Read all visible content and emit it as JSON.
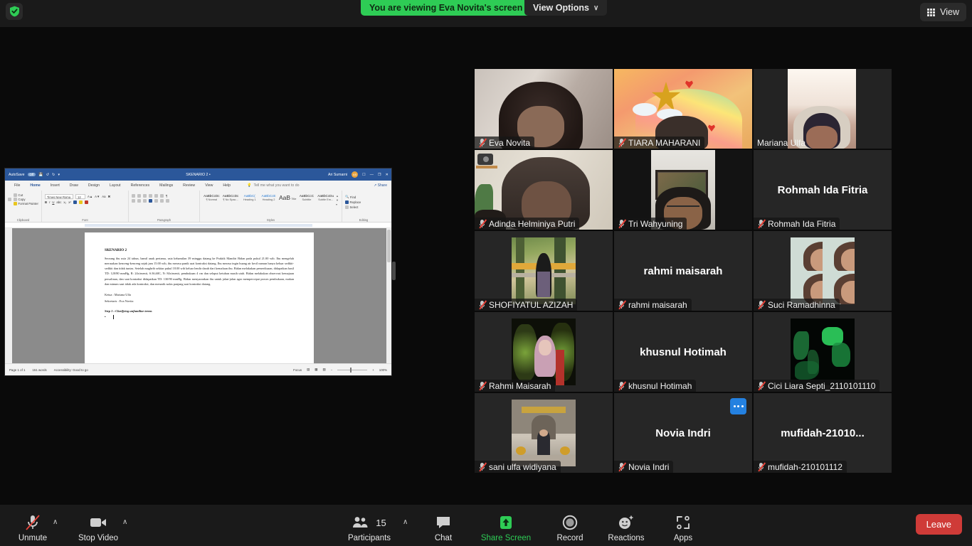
{
  "top_bar": {
    "shield_icon": "shield-check-icon",
    "viewing_banner": "You are viewing Eva Novita's screen",
    "view_options_label": "View Options",
    "view_options_chevron": "∨",
    "view_button_label": "View",
    "view_button_icon": "grid-icon"
  },
  "shared_screen": {
    "app": "Microsoft Word",
    "titlebar": {
      "autosave_label": "AutoSave",
      "autosave_state": "Off",
      "save_icon": "save-icon",
      "undo_icon": "undo-icon",
      "redo_icon": "redo-icon",
      "customize_icon": "customize-icon",
      "doc_title": "SKENARIO 2 •",
      "user_name": "Ari Sumarni",
      "user_initials": "AS",
      "ribbon_display_icon": "ribbon-display-icon",
      "minimize_icon": "—",
      "restore_icon": "❐",
      "close_icon": "✕"
    },
    "tabs": [
      "File",
      "Home",
      "Insert",
      "Draw",
      "Design",
      "Layout",
      "References",
      "Mailings",
      "Review",
      "View",
      "Help"
    ],
    "active_tab": "Home",
    "tell_me": "Tell me what you want to do",
    "share_label": "Share",
    "ribbon_groups": [
      "Clipboard",
      "Font",
      "Paragraph",
      "Styles",
      "Editing"
    ],
    "clipboard": {
      "paste_label": "Paste",
      "cut_label": "Cut",
      "copy_label": "Copy",
      "format_painter_label": "Format Painter"
    },
    "font": {
      "font_name": "Times New Roma",
      "font_size": "12",
      "bold": "B",
      "italic": "I",
      "underline": "U"
    },
    "styles": [
      {
        "preview": "AaBbCcDc",
        "name": "¶ Normal",
        "kind": "normal"
      },
      {
        "preview": "AaBbCcDc",
        "name": "¶ No Spac...",
        "kind": "normal"
      },
      {
        "preview": "AaBbC(",
        "name": "Heading 1",
        "kind": "heading"
      },
      {
        "preview": "AaBbCcE",
        "name": "Heading 2",
        "kind": "heading"
      },
      {
        "preview": "AaB",
        "name": "Title",
        "kind": "title"
      },
      {
        "preview": "AaBbCcC",
        "name": "Subtitle",
        "kind": "normal"
      },
      {
        "preview": "AaBbCcDu",
        "name": "Subtle Em...",
        "kind": "normal"
      }
    ],
    "editing": {
      "find_label": "Find",
      "replace_label": "Replace",
      "select_label": "Select"
    },
    "document": {
      "heading": "SKENARIO 2",
      "paragraph": "Seorang ibu usia 24 tahun, hamil anak pertama, usia kehamilan 39 minggu datang ke Praktik Mandiri Bidan pada pukul 21.00 wib. Ibu mengeluh merasakan kenceng-kenceng sejak jam 15.00 wib, ibu merasa panik saat kontraksi datang. Ibu merasa ingin buang air kecil namun hanya keluar sedikit-sedikit dan tidak tuntas. Setelah maghrib sekitar pukul 18.00 wib keluar lendir darah dari kemaluan ibu. Bidan melakukan pemeriksaan, didapatkan hasil TD: 120/80 mmHg, R: 24x/menit, S:36,60C, N: 84x/menit, pembukaan 4 cm dan selaput ketuban masih utuh. Bidan melakukan observasi kemajuan persalinan, dan saat kontraksi didapatkan TD: 130/90 mmHg. Bidan menyarankan ibu untuk jalan-jalan agar mempercepat proses pembukaan, makan dan minum saat tidak ada kontraksi, dan menarik nafas panjang saat kontraksi datang.",
      "ketua_line": "Ketua : Mariana Ulfa",
      "sekretaris_line": "Sekretaris : Eva Novita",
      "step_line": "Step 1 : Clarifying unfamiliar terms",
      "bullet": "•"
    },
    "status_bar": {
      "page": "Page 1 of 1",
      "words": "151 words",
      "accessibility": "Accessibility: Good to go",
      "focus_label": "Focus",
      "zoom_level": "100%",
      "zoom_out": "−",
      "zoom_in": "+"
    }
  },
  "participants": [
    {
      "name": "Eva Novita",
      "muted": true,
      "speaking": false,
      "video": "on",
      "label_position": "bottom",
      "bg": "#8b7f78"
    },
    {
      "name": "TIARA MAHARANI",
      "muted": true,
      "speaking": false,
      "video": "on",
      "label_position": "bottom",
      "bg": "#e8a060"
    },
    {
      "name": "Mariana Ulfa",
      "muted": false,
      "speaking": true,
      "video": "on",
      "label_position": "bottom",
      "bg": "#2a2a2a"
    },
    {
      "name": "Adinda Helminiya Putri",
      "muted": true,
      "speaking": false,
      "video": "on",
      "label_position": "bottom",
      "bg": "#b9b0a4"
    },
    {
      "name": "Tri Wahyuning",
      "muted": true,
      "speaking": false,
      "video": "on",
      "label_position": "bottom",
      "bg": "#1f1f1f"
    },
    {
      "name": "Rohmah Ida Fitria",
      "muted": true,
      "speaking": false,
      "video": "off",
      "label_position": "bottom",
      "bg": "#262626"
    },
    {
      "name": "SHOFIYATUL AZIZAH",
      "muted": true,
      "speaking": false,
      "video": "avatar",
      "label_position": "bottom",
      "bg": "#262626"
    },
    {
      "name": "rahmi maisarah",
      "muted": true,
      "speaking": false,
      "video": "off",
      "label_position": "bottom",
      "bg": "#262626"
    },
    {
      "name": "Suci Ramadhinna",
      "muted": true,
      "speaking": false,
      "video": "avatar",
      "label_position": "bottom",
      "bg": "#262626"
    },
    {
      "name": "Rahmi Maisarah",
      "muted": true,
      "speaking": false,
      "video": "avatar",
      "label_position": "bottom",
      "bg": "#262626"
    },
    {
      "name": "khusnul Hotimah",
      "muted": true,
      "speaking": false,
      "video": "off",
      "label_position": "bottom",
      "bg": "#262626"
    },
    {
      "name": "Cici Liara Septi_2110101110",
      "muted": true,
      "speaking": false,
      "video": "avatar",
      "label_position": "bottom",
      "bg": "#262626"
    },
    {
      "name": "sani ulfa widiyana",
      "muted": true,
      "speaking": false,
      "video": "avatar",
      "label_position": "bottom",
      "bg": "#262626"
    },
    {
      "name": "Novia Indri",
      "muted": true,
      "speaking": false,
      "video": "off",
      "label_position": "bottom",
      "bg": "#262626"
    },
    {
      "name": "mufidah-210101112",
      "muted": true,
      "speaking": false,
      "video": "off",
      "label_position": "bottom",
      "bg": "#262626"
    }
  ],
  "center_names": {
    "rohmah": "Rohmah Ida Fitria",
    "rahmi": "rahmi maisarah",
    "khusnul": "khusnul Hotimah",
    "novia": "Novia Indri",
    "mufidah": "mufidah-21010..."
  },
  "more_options_button": "more-options-icon",
  "toolbar": {
    "mute_label": "Unmute",
    "mute_icon": "microphone-muted-icon",
    "video_label": "Stop Video",
    "video_icon": "video-camera-icon",
    "participants_label": "Participants",
    "participants_count": "15",
    "participants_icon": "people-icon",
    "chat_label": "Chat",
    "chat_icon": "chat-bubble-icon",
    "share_label": "Share Screen",
    "share_icon": "share-screen-up-arrow-icon",
    "record_label": "Record",
    "record_icon": "record-circle-icon",
    "reactions_label": "Reactions",
    "reactions_icon": "smiley-plus-icon",
    "apps_label": "Apps",
    "apps_icon": "apps-bracket-icon",
    "leave_label": "Leave",
    "caret": "∧"
  }
}
